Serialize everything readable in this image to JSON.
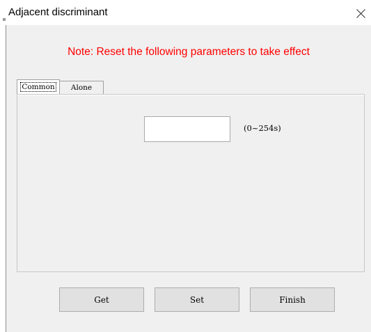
{
  "window": {
    "title": "Adjacent discriminant",
    "close_glyph": "✕"
  },
  "note": "Note: Reset the following parameters to take effect",
  "tabs": [
    {
      "label": "Common",
      "selected": true
    },
    {
      "label": "Alone",
      "selected": false
    }
  ],
  "panel": {
    "input": {
      "value": "",
      "placeholder": ""
    },
    "range_label": "(0~254s)"
  },
  "buttons": {
    "get": "Get",
    "set": "Set",
    "finish": "Finish"
  },
  "colors": {
    "note": "#ff0000",
    "background": "#f0f0f0",
    "button_face": "#e1e1e1"
  },
  "icons": {
    "close": "close-icon"
  }
}
